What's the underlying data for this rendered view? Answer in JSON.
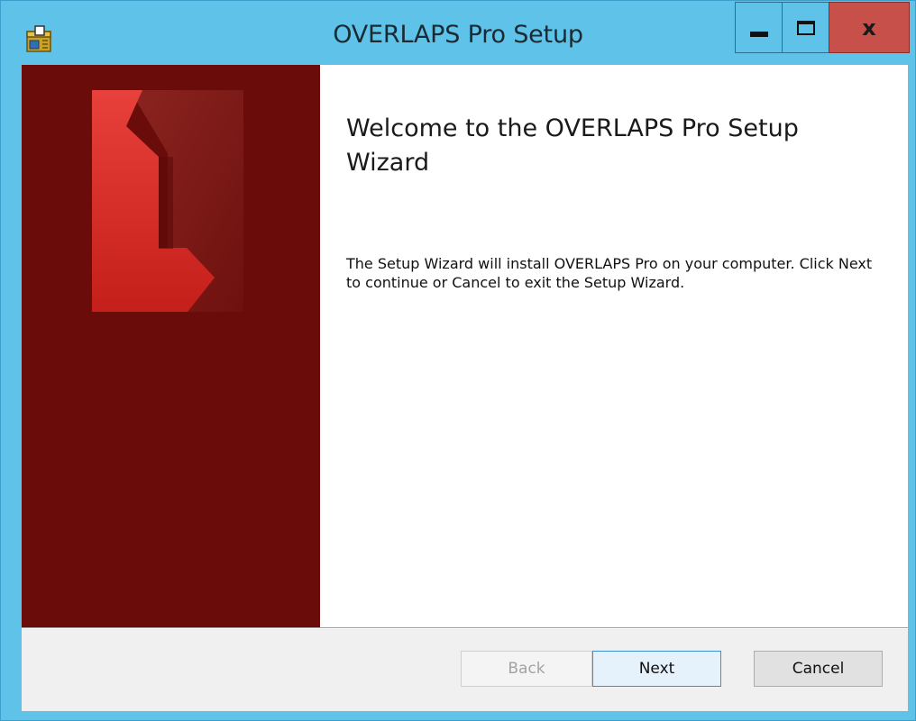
{
  "window": {
    "title": "OVERLAPS Pro Setup",
    "app_icon": "installer-package-icon",
    "controls": {
      "minimize_icon": "minimize-icon",
      "maximize_icon": "maximize-icon",
      "close_icon": "close-icon",
      "close_glyph": "x"
    }
  },
  "banner": {
    "background_color": "#6a0d0a",
    "logo": "overlaps-logo"
  },
  "content": {
    "heading": "Welcome to the OVERLAPS Pro Setup Wizard",
    "body": "The Setup Wizard will install OVERLAPS Pro on your computer. Click Next to continue or Cancel to exit the Setup Wizard."
  },
  "buttons": {
    "back_label": "Back",
    "back_enabled": false,
    "next_label": "Next",
    "next_default": true,
    "cancel_label": "Cancel"
  },
  "colors": {
    "titlebar": "#5ec2e9",
    "close_button": "#c7504a",
    "banner": "#6a0d0a",
    "logo_primary": "#d42a26",
    "default_button_border": "#3c8fd1"
  }
}
